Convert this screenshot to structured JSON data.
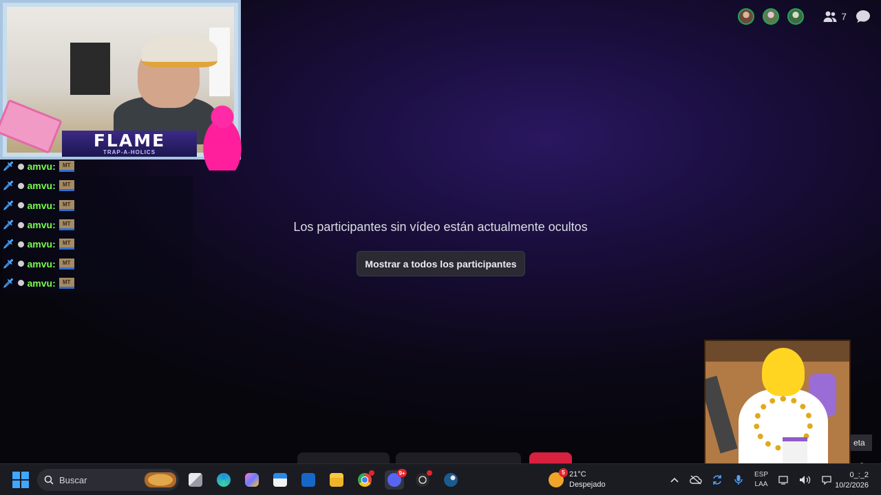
{
  "topbar": {
    "participant_count": "7"
  },
  "main": {
    "message": "Los participantes sin vídeo están actualmente ocultos",
    "show_all_button": "Mostrar a todos los participantes"
  },
  "webcam_overlay": {
    "banner_title": "FLAME",
    "banner_subtitle": "TRAP-A-HOLICS"
  },
  "chat": {
    "items": [
      {
        "user": "amvu:",
        "badge": "MT"
      },
      {
        "user": "amvu:",
        "badge": "MT"
      },
      {
        "user": "amvu:",
        "badge": "MT"
      },
      {
        "user": "amvu:",
        "badge": "MT"
      },
      {
        "user": "amvu:",
        "badge": "MT"
      },
      {
        "user": "amvu:",
        "badge": "MT"
      },
      {
        "user": "amvu:",
        "badge": "MT"
      }
    ]
  },
  "tooltip": {
    "text": "eta"
  },
  "taskbar": {
    "search_placeholder": "Buscar",
    "discord_badge": "9+",
    "weather": {
      "badge": "5",
      "temperature": "21°C",
      "condition": "Despejado"
    },
    "language": {
      "code": "ESP",
      "layout": "LAA"
    },
    "clock": {
      "time": "0_:_2",
      "date": "10/2/2026"
    }
  },
  "colors": {
    "speaking_ring": "#23a55a",
    "chat_username": "#78ff4a",
    "leave_button": "#d8203f",
    "windows_blue": "#3fa7ff"
  }
}
